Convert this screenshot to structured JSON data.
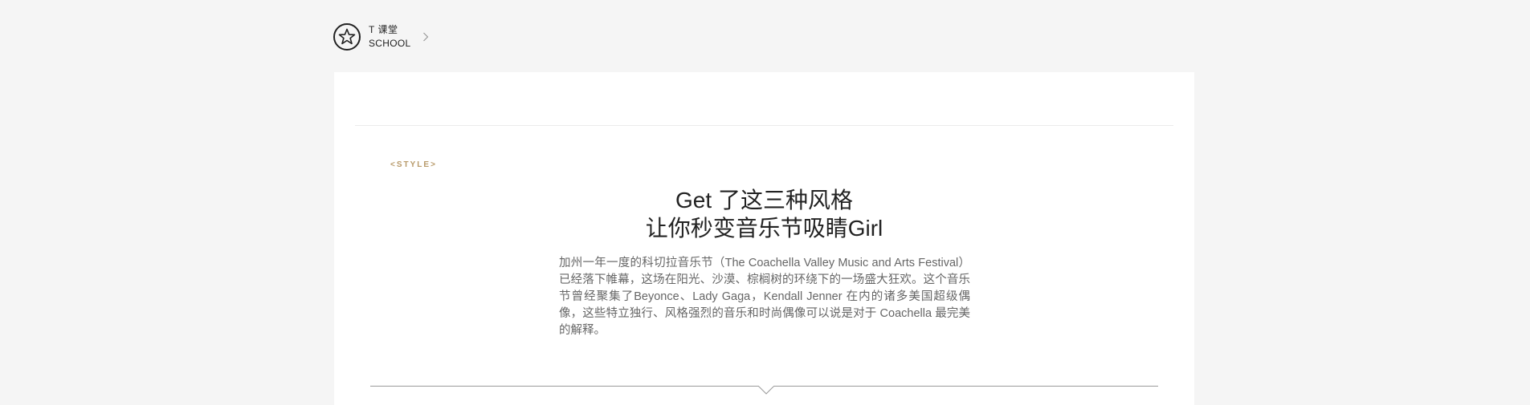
{
  "header": {
    "brand_line1": "T 课堂",
    "brand_line2": "SCHOOL",
    "logo_icon": "star-icon",
    "chevron_icon": "chevron-right-icon"
  },
  "article": {
    "tag": "<STYLE>",
    "title_line1": "Get 了这三种风格",
    "title_line2": "让你秒变音乐节吸睛Girl",
    "description": "加州一年一度的科切拉音乐节（The Coachella Valley Music and Arts Festival）已经落下帷幕，这场在阳光、沙漠、棕榈树的环绕下的一场盛大狂欢。这个音乐节曾经聚集了Beyonce、Lady Gaga，Kendall Jenner 在内的诸多美国超级偶像，这些特立独行、风格强烈的音乐和时尚偶像可以说是对于 Coachella 最完美的解释。"
  },
  "colors": {
    "background": "#f5f5f5",
    "card": "#ffffff",
    "tag": "#b89a6a",
    "text": "#222222",
    "description": "#666666"
  }
}
